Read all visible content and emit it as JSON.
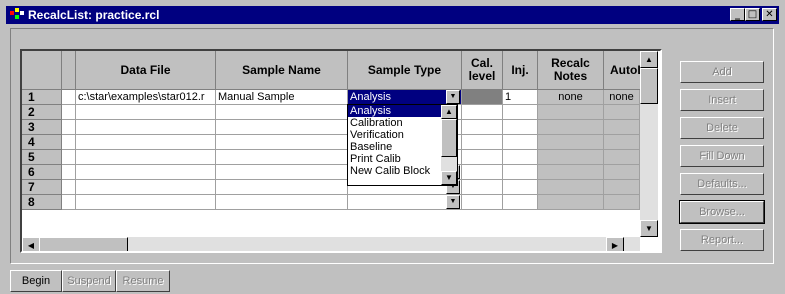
{
  "window": {
    "title": "RecalcList: practice.rcl",
    "minimize": "_",
    "maximize": "□",
    "close": "✕"
  },
  "grid": {
    "columns": [
      "Data File",
      "Sample Name",
      "Sample Type",
      "Cal.\nlevel",
      "Inj.",
      "Recalc\nNotes",
      "AutoLi"
    ],
    "rows": [
      {
        "num": "1",
        "data_file": "c:\\star\\examples\\star012.r",
        "sample_name": "Manual Sample",
        "sample_type": "Analysis",
        "cal_level": "",
        "inj": "1",
        "recalc_notes": "none",
        "autolink": "none"
      },
      {
        "num": "2"
      },
      {
        "num": "3"
      },
      {
        "num": "4"
      },
      {
        "num": "5"
      },
      {
        "num": "6"
      },
      {
        "num": "7"
      },
      {
        "num": "8"
      }
    ]
  },
  "dropdown": {
    "options": [
      "Analysis",
      "Calibration",
      "Verification",
      "Baseline",
      "Print Calib",
      "New Calib Block"
    ],
    "selected": "Analysis"
  },
  "side_buttons": [
    "Add",
    "Insert",
    "Delete",
    "Fill Down",
    "Defaults...",
    "Browse...",
    "Report..."
  ],
  "bottom_buttons": [
    "Begin",
    "Suspend",
    "Resume"
  ]
}
